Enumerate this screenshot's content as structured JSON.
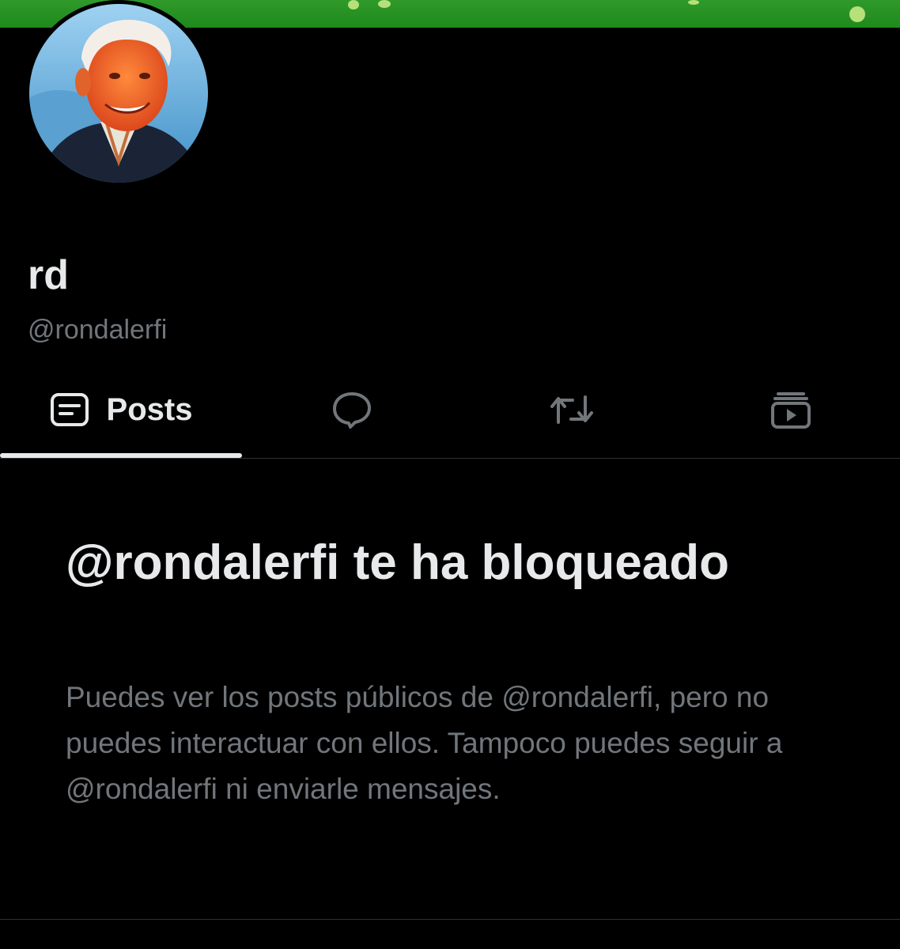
{
  "profile": {
    "display_name": "rd",
    "handle": "@rondalerfi"
  },
  "tabs": [
    {
      "label": "Posts",
      "icon": "posts-icon",
      "selected": true
    },
    {
      "label": "",
      "icon": "replies-bubble-icon",
      "selected": false
    },
    {
      "label": "",
      "icon": "repost-icon",
      "selected": false
    },
    {
      "label": "",
      "icon": "media-icon",
      "selected": false
    }
  ],
  "blocked": {
    "title": "@rondalerfi te ha bloqueado",
    "message": "Puedes ver los posts públicos de @rondalerfi, pero no puedes interactuar con ellos. Tampoco puedes seguir a @rondalerfi ni enviarle mensajes."
  },
  "colors": {
    "background": "#000000",
    "primary_text": "#e7e9ea",
    "secondary_text": "#71767b",
    "banner": "#2f9a2a",
    "divider": "#2f3336"
  }
}
